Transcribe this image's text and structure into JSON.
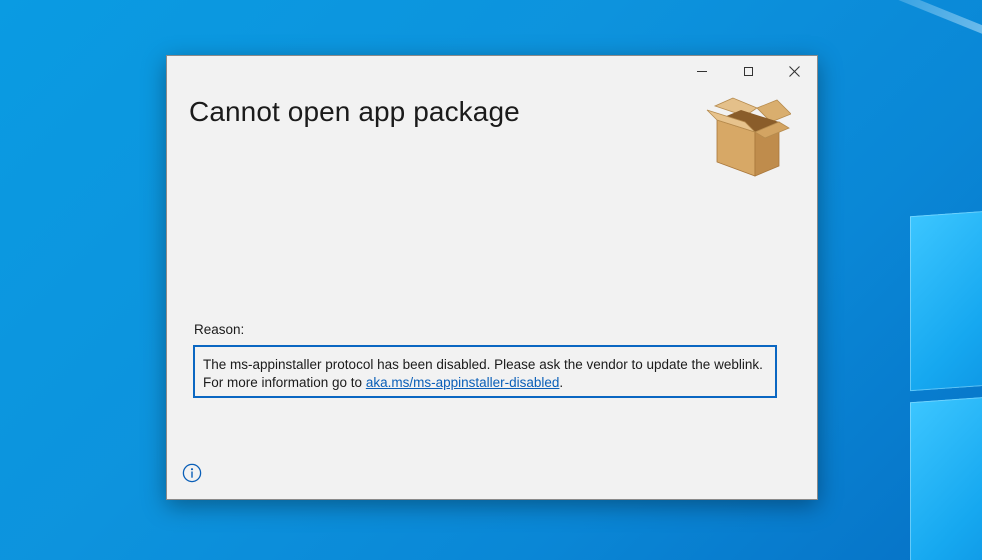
{
  "dialog": {
    "title": "Cannot open app package",
    "reason_label": "Reason:",
    "reason_text": "The ms-appinstaller protocol has been disabled. Please ask the vendor to update the weblink. For more information go to ",
    "reason_link": "aka.ms/ms-appinstaller-disabled",
    "reason_suffix": "."
  },
  "icons": {
    "minimize": "minimize-icon",
    "maximize": "maximize-icon",
    "close": "close-icon",
    "package": "package-box-icon",
    "info": "info-icon"
  },
  "colors": {
    "accent": "#0a67c2",
    "link": "#0a5fb8",
    "window_bg": "#f2f2f2",
    "desktop_bg": "#0a9be2"
  }
}
